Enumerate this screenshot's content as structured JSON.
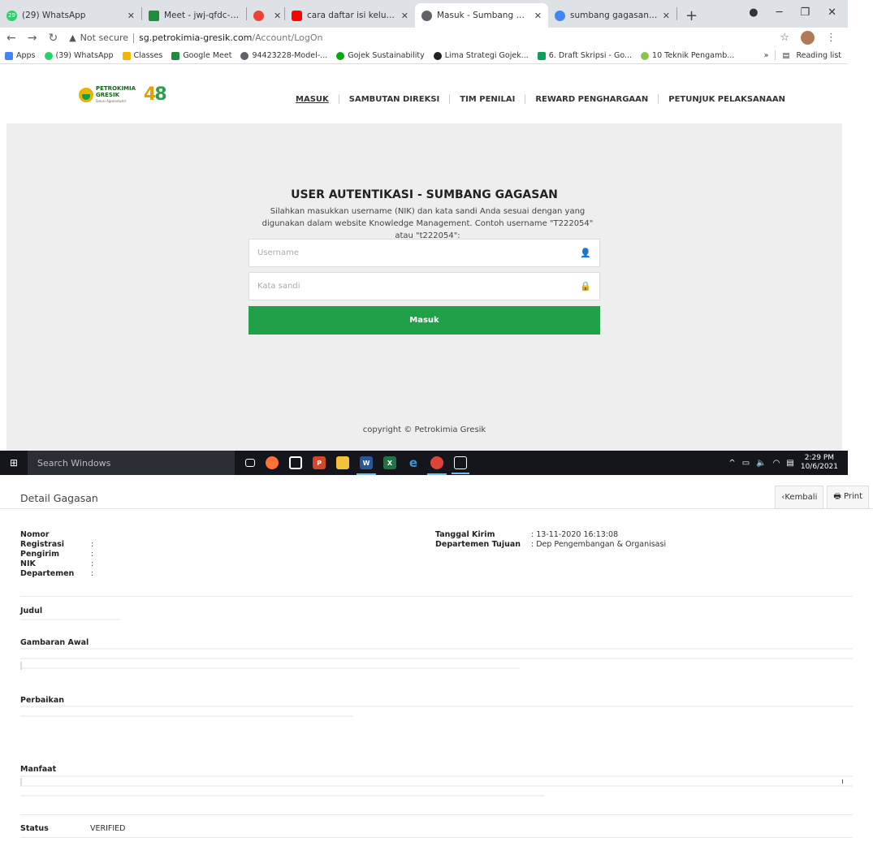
{
  "browser": {
    "tabs": [
      {
        "label": "(29) WhatsApp",
        "icon": "whatsapp-icon",
        "color": "#25d366",
        "badge": "29"
      },
      {
        "label": "Meet - jwj-qfdc-oyn",
        "icon": "meet-icon",
        "color": "#1e8e3e"
      },
      {
        "label": "",
        "icon": "record-icon",
        "color": "#ea4335"
      },
      {
        "label": "cara daftar isi keluar sampe h",
        "icon": "youtube-icon",
        "color": "#ff0000"
      },
      {
        "label": "Masuk - Sumbang Gagasan P",
        "icon": "globe-icon",
        "color": "#5f6368"
      },
      {
        "label": "sumbang gagasan adalah - G",
        "icon": "google-icon",
        "color": "#4285f4"
      }
    ],
    "url_warning": "Not secure",
    "url_host": "sg.petrokimia-gresik.com",
    "url_path": "/Account/LogOn",
    "bookmarks": [
      {
        "label": "Apps",
        "color": "#4285f4"
      },
      {
        "label": "(39) WhatsApp",
        "color": "#25d366"
      },
      {
        "label": "Classes",
        "color": "#f4b400"
      },
      {
        "label": "Google Meet",
        "color": "#1e8e3e"
      },
      {
        "label": "94423228-Model-...",
        "color": "#5f6368"
      },
      {
        "label": "Gojek Sustainability",
        "color": "#00aa13"
      },
      {
        "label": "Lima Strategi Gojek...",
        "color": "#222222"
      },
      {
        "label": "6. Draft Skripsi - Go...",
        "color": "#0f9d58"
      },
      {
        "label": "10 Teknik Pengamb...",
        "color": "#8bc34a"
      }
    ],
    "reading_list": "Reading list",
    "more": "»"
  },
  "site": {
    "logo_name": "PETROKIMIA",
    "logo_name2": "GRESIK",
    "logo_sub": "Solusi Agroindustri",
    "logo_48a": "4",
    "logo_48b": "8",
    "nav": [
      "MASUK",
      "SAMBUTAN DIREKSI",
      "TIM PENILAI",
      "REWARD PENGHARGAAN",
      "PETUNJUK PELAKSANAAN"
    ],
    "login_title": "USER AUTENTIKASI - SUMBANG GAGASAN",
    "login_desc": "Silahkan masukkan username (NIK) dan kata sandi Anda sesuai dengan yang digunakan dalam website Knowledge Management. Contoh username \"T222054\" atau \"t222054\":",
    "username_placeholder": "Username",
    "password_placeholder": "Kata sandi",
    "submit": "Masuk",
    "copyright": "copyright © Petrokimia Gresik"
  },
  "taskbar": {
    "search": "Search Windows",
    "time": "2:29 PM",
    "date": "10/6/2021",
    "apps": [
      {
        "name": "task-view-icon",
        "color": "#14161b",
        "glyph": "▢"
      },
      {
        "name": "firefox-icon",
        "color": "#ff7139",
        "glyph": "●"
      },
      {
        "name": "store-icon",
        "color": "#14161b",
        "glyph": "🛍"
      },
      {
        "name": "powerpoint-icon",
        "color": "#d24726",
        "glyph": "P"
      },
      {
        "name": "file-explorer-icon",
        "color": "#f3c13a",
        "glyph": "▬"
      },
      {
        "name": "word-icon",
        "color": "#2b579a",
        "glyph": "W"
      },
      {
        "name": "excel-icon",
        "color": "#217346",
        "glyph": "X"
      },
      {
        "name": "edge-icon",
        "color": "#14161b",
        "glyph": "e"
      },
      {
        "name": "chrome-icon",
        "color": "#db4437",
        "glyph": "◉"
      },
      {
        "name": "photos-icon",
        "color": "#14161b",
        "glyph": "▲"
      }
    ]
  },
  "detail": {
    "title": "Detail Gagasan",
    "back": "‹Kembali",
    "print": "Print",
    "left_fields": [
      {
        "label": "Nomor Registrasi",
        "value": ""
      },
      {
        "label": "Pengirim",
        "value": ""
      },
      {
        "label": "NIK",
        "value": ""
      },
      {
        "label": "Departemen",
        "value": ""
      }
    ],
    "right_fields": [
      {
        "label": "Tanggal Kirim",
        "value": ": 13-11-2020 16:13:08"
      },
      {
        "label": "Departemen Tujuan",
        "value": ": Dep Pengembangan & Organisasi"
      }
    ],
    "sections": [
      "Judul",
      "Gambaran Awal",
      "Perbaikan",
      "Manfaat"
    ],
    "status_label": "Status",
    "status_value": "VERIFIED"
  }
}
